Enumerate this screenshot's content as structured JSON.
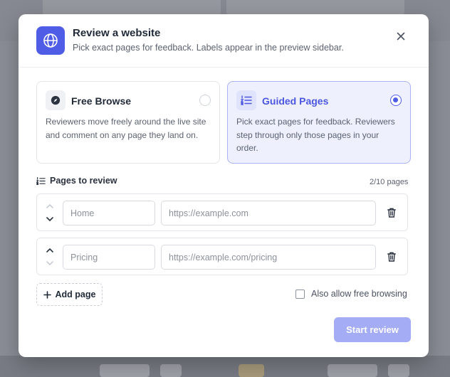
{
  "modal": {
    "title": "Review a website",
    "subtitle": "Pick exact pages for feedback. Labels appear in the preview sidebar.",
    "close_icon": "close-icon",
    "logo_icon": "globe-icon"
  },
  "modes": {
    "free": {
      "title": "Free Browse",
      "description": "Reviewers move freely around the live site and comment on any page they land on.",
      "icon": "compass-icon",
      "selected": false
    },
    "guided": {
      "title": "Guided Pages",
      "description": "Pick exact pages for feedback. Reviewers step through only those pages in your order.",
      "icon": "ordered-list-icon",
      "selected": true
    }
  },
  "pages": {
    "section_title": "Pages to review",
    "count": "2/10 pages",
    "rows": [
      {
        "label_placeholder": "Home",
        "url_placeholder": "https://example.com"
      },
      {
        "label_placeholder": "Pricing",
        "url_placeholder": "https://example.com/pricing"
      }
    ],
    "add_label": "Add page"
  },
  "options": {
    "allow_free_browsing": "Also allow free browsing",
    "allow_checked": false
  },
  "footer": {
    "start_label": "Start review"
  },
  "colors": {
    "accent": "#4f5ce6",
    "accent_soft": "#eef0fd",
    "disabled_button": "#a3acf5"
  }
}
